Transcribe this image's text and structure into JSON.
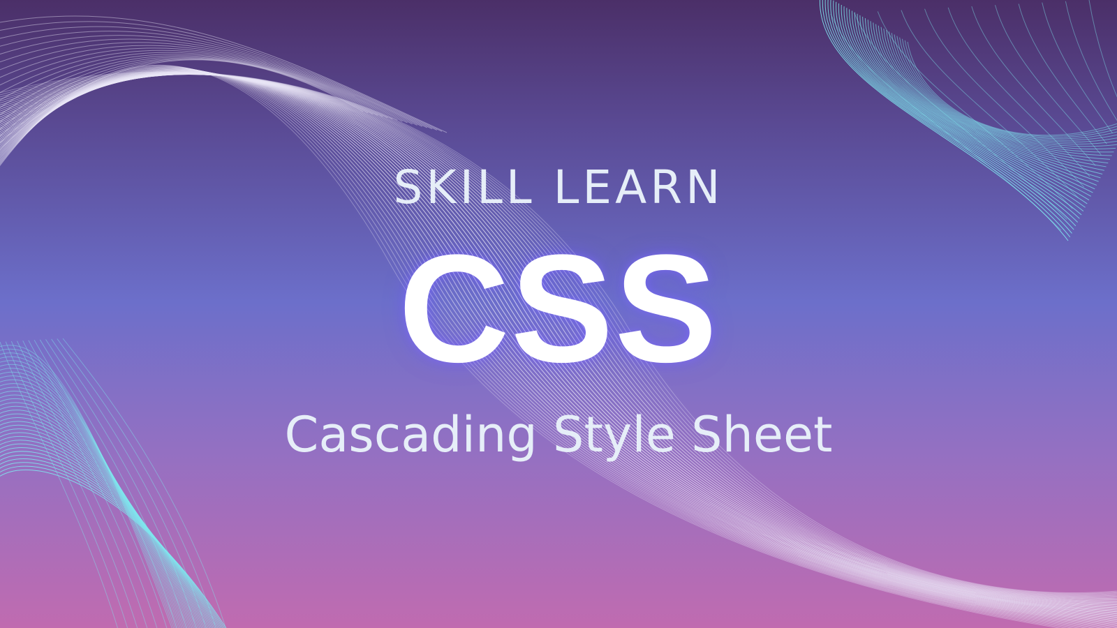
{
  "slide": {
    "kicker": "SKILL LEARN",
    "headline": "CSS",
    "subtitle": "Cascading Style Sheet"
  },
  "colors": {
    "gradient_top": "#4b2f68",
    "gradient_mid": "#6c6fca",
    "gradient_bottom": "#c06bb0",
    "text_light": "#e6eef8",
    "headline": "#ffffff",
    "white_wave": "#e9e6f6",
    "cyan_wave": "#7fe6ee"
  }
}
